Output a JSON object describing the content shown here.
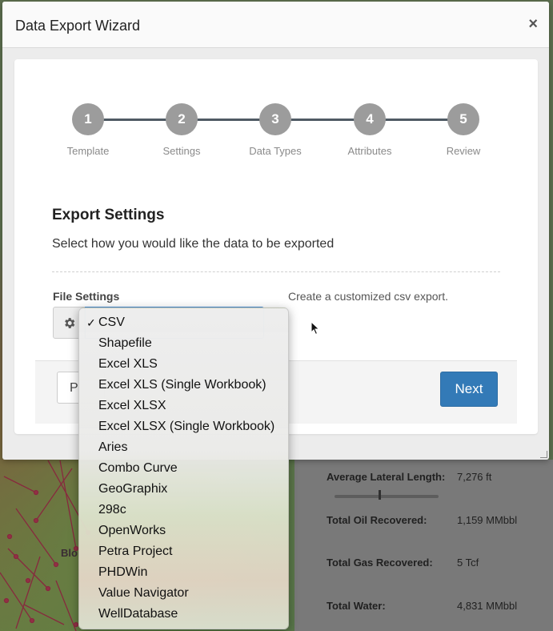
{
  "window": {
    "title": "Data Export Wizard",
    "close_glyph": "×"
  },
  "stepper": {
    "steps": [
      {
        "number": "1",
        "label": "Template"
      },
      {
        "number": "2",
        "label": "Settings"
      },
      {
        "number": "3",
        "label": "Data Types"
      },
      {
        "number": "4",
        "label": "Attributes"
      },
      {
        "number": "5",
        "label": "Review"
      }
    ]
  },
  "section": {
    "title": "Export Settings",
    "description": "Select how you would like the data to be exported"
  },
  "file_settings": {
    "label": "File Settings",
    "export_description": "Create a customized csv export.",
    "selected": "CSV"
  },
  "format_options": [
    {
      "label": "CSV",
      "checked": true
    },
    {
      "label": "Shapefile",
      "checked": false
    },
    {
      "label": "Excel XLS",
      "checked": false
    },
    {
      "label": "Excel XLS (Single Workbook)",
      "checked": false
    },
    {
      "label": "Excel XLSX",
      "checked": false
    },
    {
      "label": "Excel XLSX (Single Workbook)",
      "checked": false
    },
    {
      "label": "Aries",
      "checked": false
    },
    {
      "label": "Combo Curve",
      "checked": false
    },
    {
      "label": "GeoGraphix",
      "checked": false
    },
    {
      "label": "298c",
      "checked": false
    },
    {
      "label": "OpenWorks",
      "checked": false
    },
    {
      "label": "Petra Project",
      "checked": false
    },
    {
      "label": "PHDWin",
      "checked": false
    },
    {
      "label": "Value Navigator",
      "checked": false
    },
    {
      "label": "WellDatabase",
      "checked": false
    }
  ],
  "check_glyph": "✓",
  "footer": {
    "prev_label_partial": "P",
    "next_label": "Next"
  },
  "background": {
    "map_label": "Blo",
    "stats": [
      {
        "label": "Average Lateral Length:",
        "value": "7,276 ft"
      },
      {
        "label": "Total Oil Recovered:",
        "value": "1,159 MMbbl"
      },
      {
        "label": "Total Gas Recovered:",
        "value": "5 Tcf"
      },
      {
        "label": "Total Water:",
        "value": "4,831 MMbbl"
      }
    ]
  },
  "colors": {
    "primary": "#337ab7",
    "step_circle": "#9c9c9c",
    "step_line": "#4f5a64"
  }
}
